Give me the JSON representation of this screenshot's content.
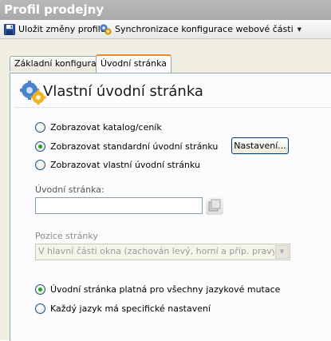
{
  "window": {
    "title": "Profil prodejny"
  },
  "toolbar": {
    "save_label": "Uložit změny profilu",
    "sync_label": "Synchronizace konfigurace webové části"
  },
  "tabs": [
    {
      "label": "Základní konfigurace",
      "active": false
    },
    {
      "label": "Úvodní stránka",
      "active": true
    }
  ],
  "panel": {
    "title": "Vlastní úvodní stránka",
    "page_type_options": [
      {
        "label": "Zobrazovat katalog/ceník",
        "selected": false
      },
      {
        "label": "Zobrazovat standardní úvodní stránku",
        "selected": true
      },
      {
        "label": "Zobrazovat vlastní úvodní stránku",
        "selected": false
      }
    ],
    "settings_button": "Nastavení...",
    "homepage_label": "Úvodní stránka:",
    "homepage_value": "",
    "position_label": "Pozice stránky",
    "position_value": "V hlavní části okna (zachován levý, horní a příp. pravý sloupec)",
    "language_options": [
      {
        "label": "Úvodní stránka platná pro všechny jazykové mutace",
        "selected": true
      },
      {
        "label": "Každý jazyk má specifické nastavení",
        "selected": false
      }
    ]
  },
  "colors": {
    "accent_tab": "#e68b2c",
    "radio_dot": "#21a121",
    "titlebar": "#adadad"
  }
}
